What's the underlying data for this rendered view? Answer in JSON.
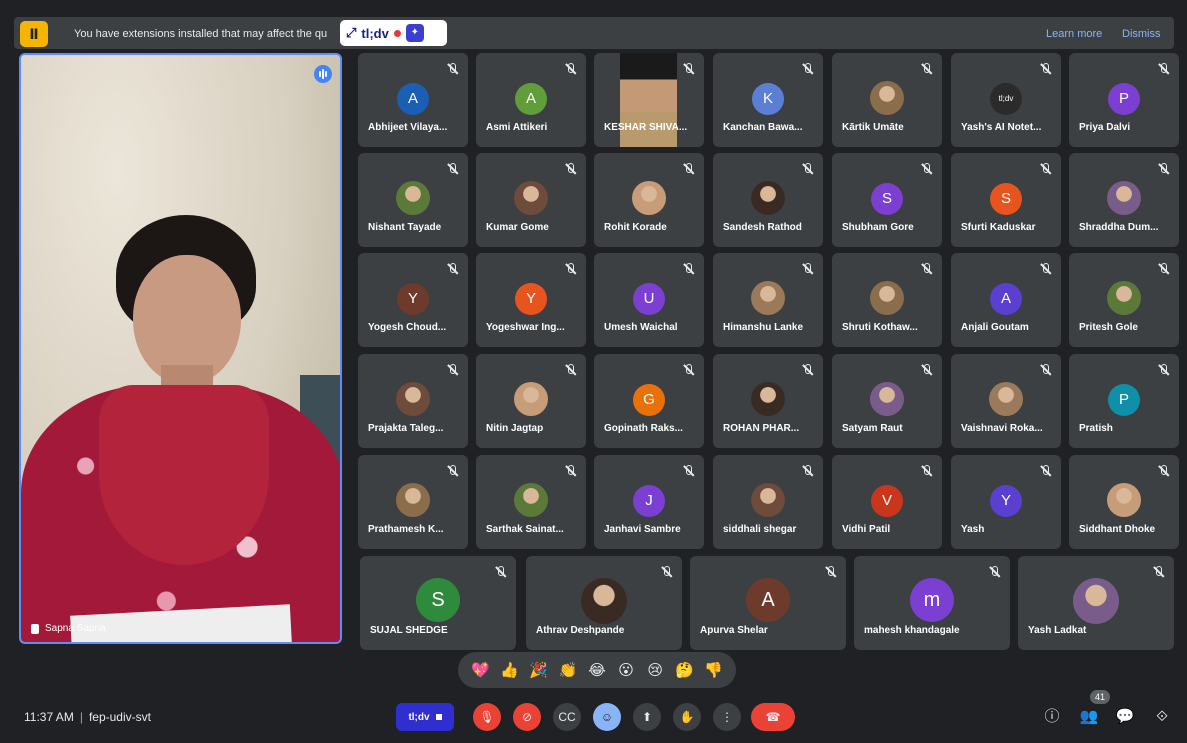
{
  "banner": {
    "icon": "extension-icon",
    "text": "You have extensions installed that may affect the qu",
    "learn_more": "Learn more",
    "dismiss": "Dismiss"
  },
  "tldv_chip": {
    "label": "tl;dv",
    "status_color": "#e53935"
  },
  "speaker": {
    "name": "Sapna Sapna"
  },
  "participants_row1": [
    {
      "name": "Abhijeet Vilaya...",
      "initial": "A",
      "color": "#1a5fb4"
    },
    {
      "name": "Asmi Attikeri",
      "initial": "A",
      "color": "#5f9e3a"
    },
    {
      "name": "KESHAR SHIVA...",
      "initial": "",
      "color": ""
    },
    {
      "name": "Kanchan Bawa...",
      "initial": "K",
      "color": "#5c7fd6"
    },
    {
      "name": "Kārtik Umāte",
      "initial": "",
      "color": ""
    },
    {
      "name": "Yash's AI Notet...",
      "initial": "tl;dv",
      "color": "#2b2b2b"
    },
    {
      "name": "Priya Dalvi",
      "initial": "P",
      "color": "#7b3fd1"
    }
  ],
  "participants_row2": [
    {
      "name": "Nishant Tayade",
      "initial": "",
      "color": ""
    },
    {
      "name": "Kumar Gome",
      "initial": "",
      "color": ""
    },
    {
      "name": "Rohit Korade",
      "initial": "",
      "color": ""
    },
    {
      "name": "Sandesh Rathod",
      "initial": "",
      "color": ""
    },
    {
      "name": "Shubham Gore",
      "initial": "S",
      "color": "#7b3fd1"
    },
    {
      "name": "Sfurti Kaduskar",
      "initial": "S",
      "color": "#e8541e"
    },
    {
      "name": "Shraddha Dum...",
      "initial": "",
      "color": ""
    }
  ],
  "participants_row3": [
    {
      "name": "Yogesh Choud...",
      "initial": "Y",
      "color": "#6d3a2c"
    },
    {
      "name": "Yogeshwar Ing...",
      "initial": "Y",
      "color": "#e8541e"
    },
    {
      "name": "Umesh Waichal",
      "initial": "U",
      "color": "#7b3fd1"
    },
    {
      "name": "Himanshu Lanke",
      "initial": "",
      "color": ""
    },
    {
      "name": "Shruti Kothaw...",
      "initial": "",
      "color": ""
    },
    {
      "name": "Anjali Goutam",
      "initial": "A",
      "color": "#5a3fd1"
    },
    {
      "name": "Pritesh Gole",
      "initial": "",
      "color": ""
    }
  ],
  "participants_row4": [
    {
      "name": "Prajakta Taleg...",
      "initial": "",
      "color": ""
    },
    {
      "name": "Nitin Jagtap",
      "initial": "",
      "color": ""
    },
    {
      "name": "Gopinath Raks...",
      "initial": "G",
      "color": "#e8710a"
    },
    {
      "name": "ROHAN PHAR...",
      "initial": "",
      "color": ""
    },
    {
      "name": "Satyam Raut",
      "initial": "",
      "color": ""
    },
    {
      "name": "Vaishnavi Roka...",
      "initial": "",
      "color": ""
    },
    {
      "name": "Pratish",
      "initial": "P",
      "color": "#0f8fa8"
    }
  ],
  "participants_row5": [
    {
      "name": "Prathamesh K...",
      "initial": "",
      "color": ""
    },
    {
      "name": "Sarthak Sainat...",
      "initial": "",
      "color": ""
    },
    {
      "name": "Janhavi Sambre",
      "initial": "J",
      "color": "#7b3fd1"
    },
    {
      "name": "siddhali shegar",
      "initial": "",
      "color": ""
    },
    {
      "name": "Vidhi Patil",
      "initial": "V",
      "color": "#c9361c"
    },
    {
      "name": "Yash",
      "initial": "Y",
      "color": "#5a3fd1"
    },
    {
      "name": "Siddhant Dhoke",
      "initial": "",
      "color": ""
    }
  ],
  "participants_row6": [
    {
      "name": "SUJAL SHEDGE",
      "initial": "S",
      "color": "#2e8b3c"
    },
    {
      "name": "Athrav Deshpande",
      "initial": "",
      "color": ""
    },
    {
      "name": "Apurva Shelar",
      "initial": "A",
      "color": "#6d3a2c"
    },
    {
      "name": "mahesh khandagale",
      "initial": "m",
      "color": "#7b3fd1"
    },
    {
      "name": "Yash Ladkat",
      "initial": "",
      "color": ""
    }
  ],
  "reactions": [
    "💖",
    "👍",
    "🎉",
    "👏",
    "😂",
    "😮",
    "😢",
    "🤔",
    "👎"
  ],
  "footer": {
    "time": "11:37 AM",
    "meeting_code": "fep-udiv-svt",
    "tldv_label": "tl;dv",
    "participant_count": "41"
  }
}
